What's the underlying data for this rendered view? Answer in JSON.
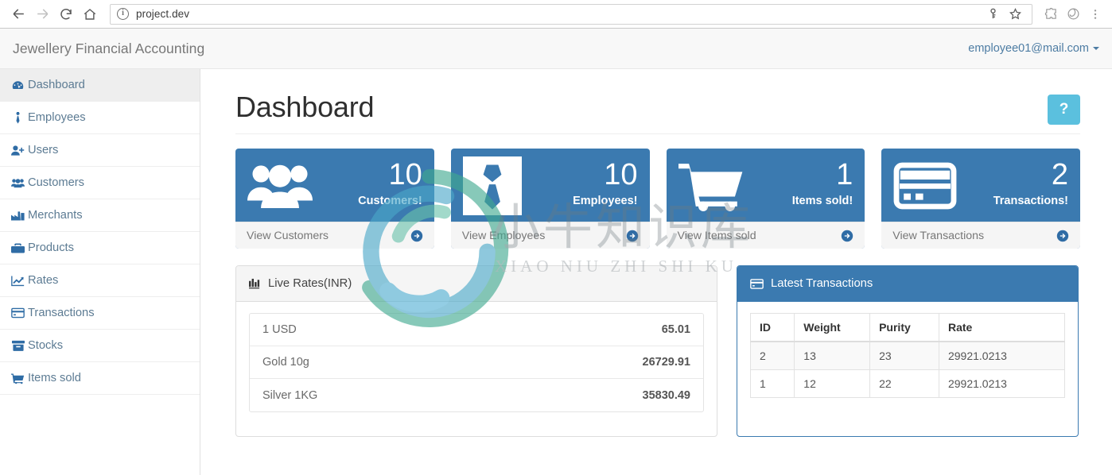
{
  "browser": {
    "back_icon": "arrow-left-icon",
    "forward_icon": "arrow-right-icon",
    "reload_icon": "reload-icon",
    "home_icon": "home-icon",
    "info_glyph": "i",
    "url": "project.dev",
    "key_icon": "key-icon",
    "star_icon": "star-icon",
    "extension_icon": "puzzle-icon",
    "profile_icon": "swirl-icon",
    "menu_icon": "three-dot-menu-icon"
  },
  "header": {
    "app_title": "Jewellery Financial Accounting",
    "user_email": "employee01@mail.com"
  },
  "sidebar": {
    "items": [
      {
        "label": "Dashboard",
        "icon": "tachometer-icon",
        "active": true
      },
      {
        "label": "Employees",
        "icon": "tie-icon",
        "active": false
      },
      {
        "label": "Users",
        "icon": "user-plus-icon",
        "active": false
      },
      {
        "label": "Customers",
        "icon": "users-group-icon",
        "active": false
      },
      {
        "label": "Merchants",
        "icon": "industry-chart-icon",
        "active": false
      },
      {
        "label": "Products",
        "icon": "briefcase-icon",
        "active": false
      },
      {
        "label": "Rates",
        "icon": "line-chart-icon",
        "active": false
      },
      {
        "label": "Transactions",
        "icon": "credit-card-icon",
        "active": false
      },
      {
        "label": "Stocks",
        "icon": "archive-box-icon",
        "active": false
      },
      {
        "label": "Items sold",
        "icon": "shopping-cart-icon",
        "active": false
      }
    ]
  },
  "main": {
    "page_title": "Dashboard",
    "help_label": "?",
    "stats": [
      {
        "count": "10",
        "label": "Customers!",
        "link": "View Customers",
        "icon": "users-group-icon"
      },
      {
        "count": "10",
        "label": "Employees!",
        "link": "View Employees",
        "icon": "tie-icon"
      },
      {
        "count": "1",
        "label": "Items sold!",
        "link": "View Items sold",
        "icon": "shopping-cart-icon"
      },
      {
        "count": "2",
        "label": "Transactions!",
        "link": "View Transactions",
        "icon": "credit-card-icon"
      }
    ],
    "rates_panel": {
      "title": "Live Rates(INR)",
      "icon": "bar-chart-icon",
      "items": [
        {
          "name": "1 USD",
          "value": "65.01"
        },
        {
          "name": "Gold 10g",
          "value": "26729.91"
        },
        {
          "name": "Silver 1KG",
          "value": "35830.49"
        }
      ]
    },
    "transactions_panel": {
      "title": "Latest Transactions",
      "icon": "credit-card-icon",
      "columns": [
        "ID",
        "Weight",
        "Purity",
        "Rate"
      ],
      "rows": [
        [
          "2",
          "13",
          "23",
          "29921.0213"
        ],
        [
          "1",
          "12",
          "22",
          "29921.0213"
        ]
      ]
    }
  },
  "watermark": {
    "text": "小牛知识库",
    "subtext": "XIAO NIU ZHI SHI KU"
  },
  "colors": {
    "panel_blue": "#3b7ab0",
    "help_cyan": "#5bc0de",
    "sidebar_link": "#5c7b93",
    "icon_blue": "#2f6ca5"
  }
}
